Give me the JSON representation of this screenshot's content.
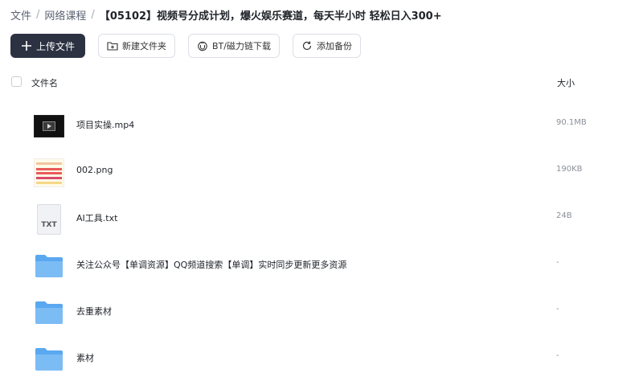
{
  "breadcrumb": {
    "items": [
      "文件",
      "网络课程"
    ],
    "current": "【05102】视频号分成计划，爆火娱乐赛道，每天半小时 轻松日入300+"
  },
  "toolbar": {
    "upload": "上传文件",
    "new_folder": "新建文件夹",
    "bt": "BT/磁力链下载",
    "backup": "添加备份"
  },
  "list": {
    "header_name": "文件名",
    "header_size": "大小",
    "files": [
      {
        "name": "项目实操.mp4",
        "size": "90.1MB",
        "icon": "video-thumbnail"
      },
      {
        "name": "002.png",
        "size": "190KB",
        "icon": "image-thumbnail"
      },
      {
        "name": "AI工具.txt",
        "size": "24B",
        "icon": "txt-file-icon",
        "icon_label": "TXT"
      },
      {
        "name": "关注公众号【单调资源】QQ频道搜索【单调】实时同步更新更多资源",
        "size": "-",
        "icon": "folder-icon"
      },
      {
        "name": "去重素材",
        "size": "-",
        "icon": "folder-icon"
      },
      {
        "name": "素材",
        "size": "-",
        "icon": "folder-icon"
      }
    ]
  },
  "colors": {
    "primary_button": "#2c3242",
    "folder": "#5aa8f0",
    "size_text": "#8a8f99"
  }
}
